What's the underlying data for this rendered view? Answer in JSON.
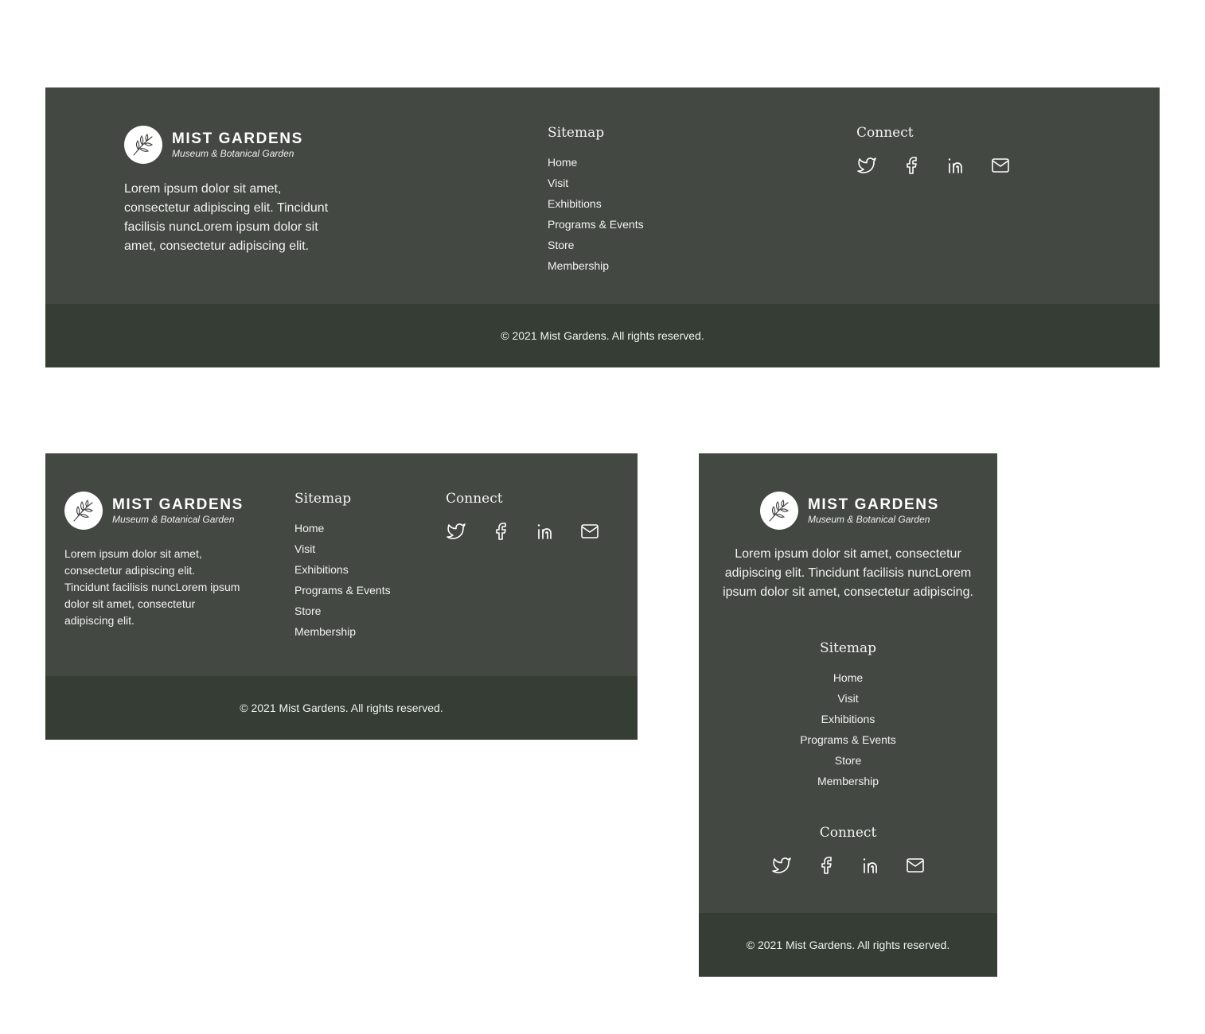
{
  "brand": {
    "name": "MIST GARDENS",
    "tagline": "Museum & Botanical Garden"
  },
  "description": {
    "desktop": "Lorem ipsum dolor sit amet, consectetur adipiscing elit. Tincidunt facilisis nuncLorem ipsum dolor sit amet, consectetur adipiscing elit.",
    "tablet": "Lorem ipsum dolor sit amet, consectetur adipiscing elit. Tincidunt facilisis nuncLorem ipsum dolor sit amet, consectetur adipiscing elit.",
    "mobile": "Lorem ipsum dolor sit amet, consectetur adipiscing elit. Tincidunt facilisis nuncLorem ipsum dolor sit amet, consectetur adipiscing."
  },
  "sitemap": {
    "title": "Sitemap",
    "items": [
      "Home",
      "Visit",
      "Exhibitions",
      "Programs & Events",
      "Store",
      "Membership"
    ]
  },
  "connect": {
    "title": "Connect",
    "icons": [
      "twitter-icon",
      "facebook-icon",
      "linkedin-icon",
      "mail-icon"
    ]
  },
  "copyright": "© 2021 Mist Gardens. All rights reserved.",
  "colors": {
    "footer_bg": "#434842",
    "bottom_bar_bg": "#353d35",
    "text": "#ffffff"
  }
}
